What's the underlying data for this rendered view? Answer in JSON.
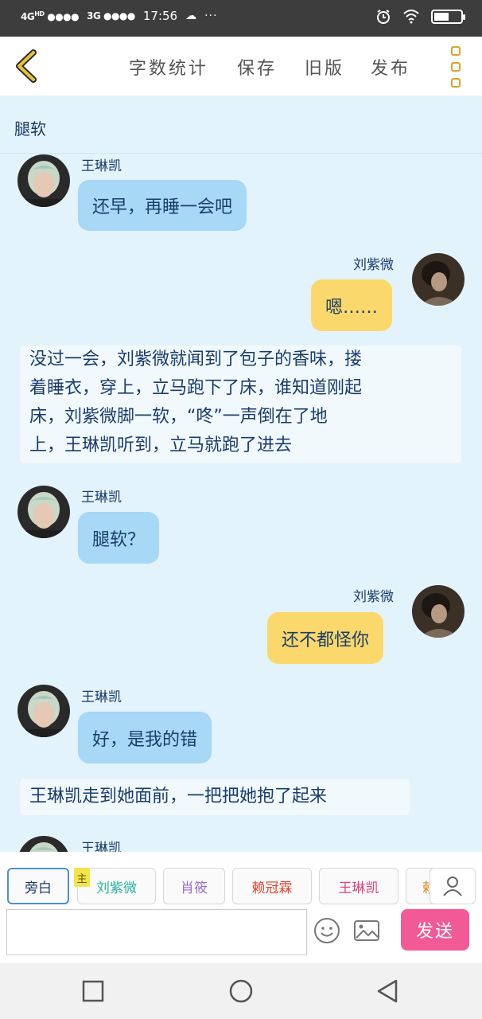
{
  "status_bar": {
    "signal1": "4G",
    "signal1_sup": "HD",
    "signal2": "3G",
    "time": "17:56",
    "dots": "···",
    "battery_percent": 0.55
  },
  "top_bar": {
    "word_count": "字数统计",
    "save": "保存",
    "old_version": "旧版",
    "publish": "发布"
  },
  "chat": {
    "title": "腿软",
    "messages": [
      {
        "type": "left",
        "name": "王琳凯",
        "text": "还早，再睡一会吧"
      },
      {
        "type": "right",
        "name": "刘紫微",
        "text": "嗯……"
      },
      {
        "type": "narration",
        "lines": [
          "没过一会，刘紫微就闻到了包子的香味，搂",
          "着睡衣，穿上，立马跑下了床，谁知道刚起",
          "床，刘紫微脚一软，“咚”一声倒在了地",
          "上，王琳凯听到，立马就跑了进去"
        ]
      },
      {
        "type": "left",
        "name": "王琳凯",
        "text": "腿软？"
      },
      {
        "type": "right",
        "name": "刘紫微",
        "text": "还不都怪你"
      },
      {
        "type": "left",
        "name": "王琳凯",
        "text": "好，是我的错"
      },
      {
        "type": "narration",
        "lines": [
          "王琳凯走到她面前，一把把她抱了起来"
        ]
      },
      {
        "type": "left",
        "name": "王琳凯",
        "text": ""
      }
    ]
  },
  "roles": {
    "main_tag": "主",
    "chips": [
      {
        "label": "旁白",
        "color": "#1a3d6b"
      },
      {
        "label": "刘紫微",
        "color": "#2bb3a3"
      },
      {
        "label": "肖筱",
        "color": "#9b6ccf"
      },
      {
        "label": "赖冠霖",
        "color": "#e0452f"
      },
      {
        "label": "王琳凯",
        "color": "#e0457f"
      },
      {
        "label": "赖",
        "color": "#e0891f"
      }
    ]
  },
  "input": {
    "placeholder": "",
    "send_label": "发送"
  },
  "colors": {
    "chat_bg": "#e3f3fb",
    "left_bubble": "#a7d8f6",
    "right_bubble": "#fbd86b",
    "send_button": "#f25a97",
    "accent": "#d4a72a"
  }
}
